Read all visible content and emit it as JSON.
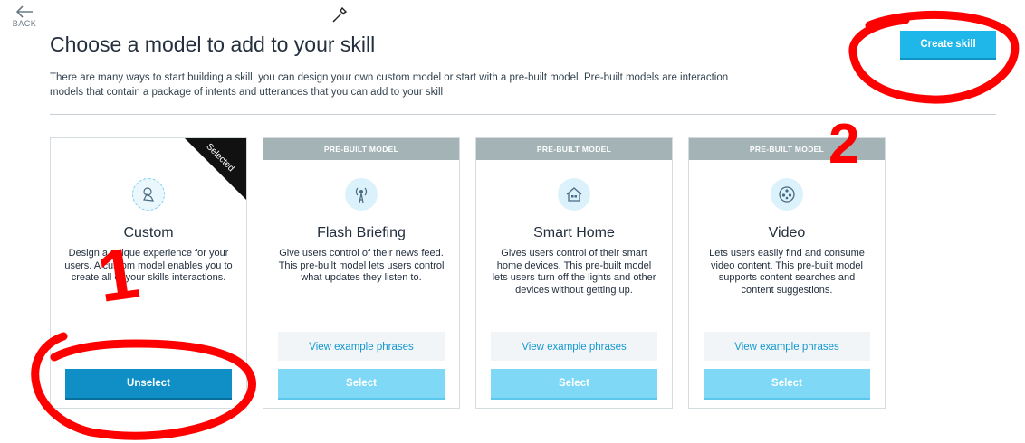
{
  "nav": {
    "back_label": "BACK"
  },
  "page": {
    "title": "Choose a model to add to your skill",
    "description": "There are many ways to start building a skill, you can design your own custom model or start with a pre-built model. Pre-built models are interaction models that contain a package of intents and utterances that you can add to your skill"
  },
  "actions": {
    "create_skill_label": "Create skill"
  },
  "cards": [
    {
      "title": "Custom",
      "ribbon": "Selected",
      "description": "Design a unique experience for your users. A custom model enables you to create all of your skills interactions.",
      "button_label": "Unselect",
      "icon": "custom-model-icon"
    },
    {
      "header": "PRE-BUILT MODEL",
      "title": "Flash Briefing",
      "description": "Give users control of their news feed. This pre-built model lets users control what updates they listen to.",
      "example_label": "View example phrases",
      "button_label": "Select",
      "icon": "broadcast-icon"
    },
    {
      "header": "PRE-BUILT MODEL",
      "title": "Smart Home",
      "description": "Gives users control of their smart home devices. This pre-built model lets users turn off the lights and other devices without getting up.",
      "example_label": "View example phrases",
      "button_label": "Select",
      "icon": "house-icon"
    },
    {
      "header": "PRE-BUILT MODEL",
      "title": "Video",
      "description": "Lets users easily find and consume video content. This pre-built model supports content searches and content suggestions.",
      "example_label": "View example phrases",
      "button_label": "Select",
      "icon": "film-reel-icon"
    }
  ],
  "annotations": {
    "label_1": "1",
    "label_2": "2",
    "color": "#ff0000"
  },
  "colors": {
    "accent": "#1fb7ea",
    "selected_button": "#0f8fc6",
    "select_button": "#7fd9f6",
    "header_bar": "#a3b3b6"
  }
}
